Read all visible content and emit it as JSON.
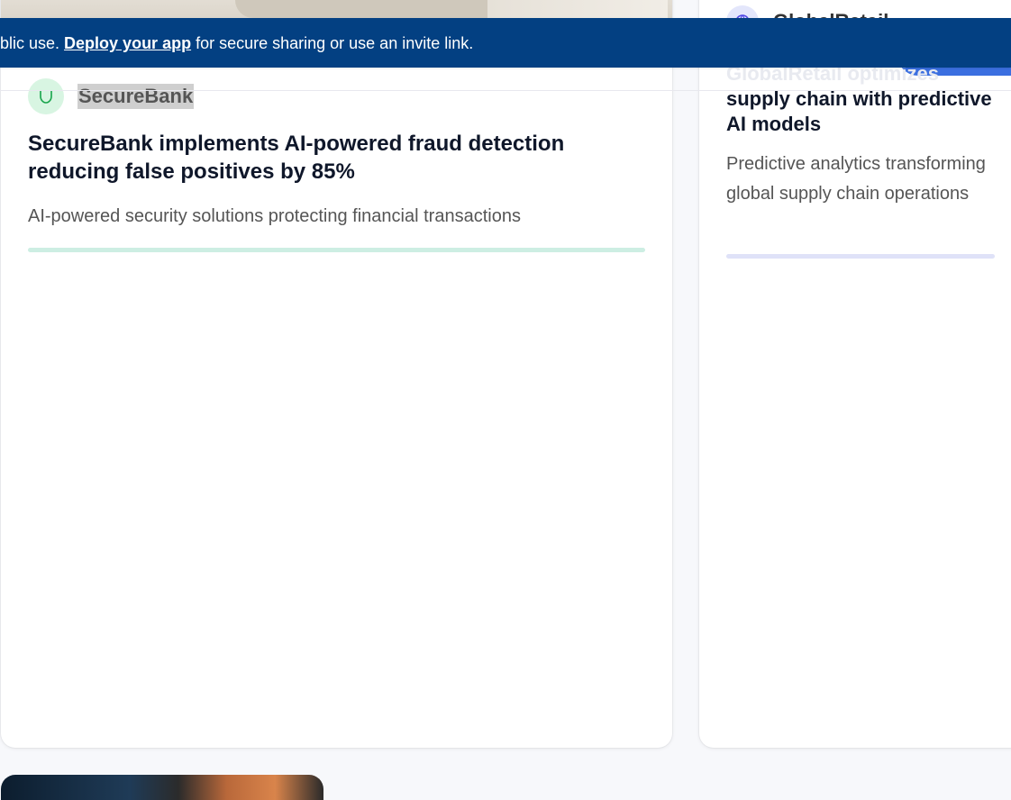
{
  "banner": {
    "prefix": "blic use. ",
    "link_label": "Deploy your app",
    "suffix": " for secure sharing or use an invite link."
  },
  "left_card": {
    "company_name": "SecureBank",
    "company_icon": "shield-icon",
    "title": "SecureBank implements AI-powered fraud detection reducing false positives by 85%",
    "description": "AI-powered security solutions protecting financial transactions",
    "accent_color": "#cdeee3"
  },
  "right_card": {
    "company_name": "GlobalRetail",
    "company_icon": "globe-icon",
    "title_faded": "GlobalRetail optimizes",
    "title": "supply chain with predictive AI models",
    "description": "Predictive analytics transforming global supply chain operations",
    "accent_color": "#dfe2f8"
  },
  "colors": {
    "banner_bg": "#034082",
    "page_bg": "#f7f8fb"
  }
}
